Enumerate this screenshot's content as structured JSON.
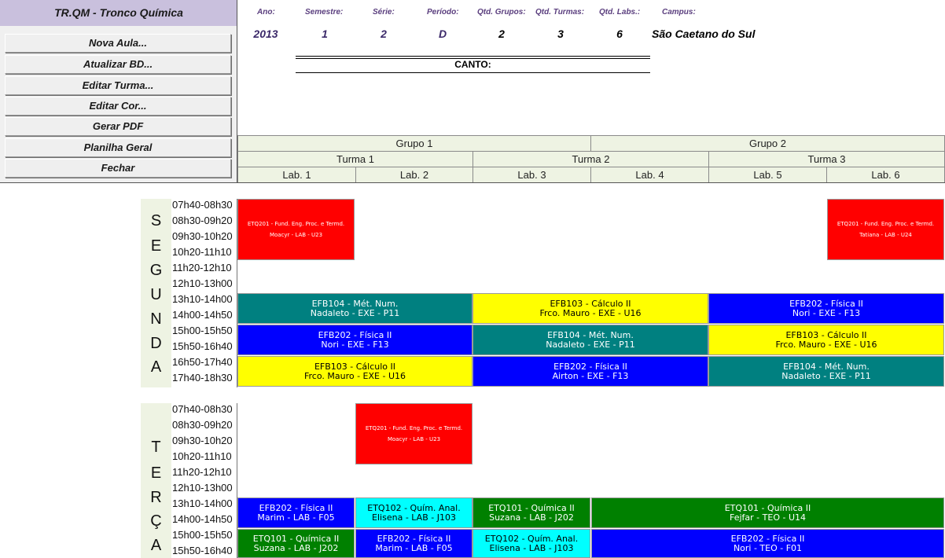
{
  "app": {
    "title": "TR.QM - Tronco Química"
  },
  "menu": {
    "nova_aula": "Nova Aula...",
    "atualizar_bd": "Atualizar BD...",
    "editar_turma": "Editar Turma...",
    "editar_cor": "Editar Cor...",
    "gerar_pdf": "Gerar PDF",
    "planilha_geral": "Planilha Geral",
    "fechar": "Fechar"
  },
  "info": {
    "labels": {
      "ano": "Ano:",
      "semestre": "Semestre:",
      "serie": "Série:",
      "periodo": "Período:",
      "qtd_grupos": "Qtd. Grupos:",
      "qtd_turmas": "Qtd. Turmas:",
      "qtd_labs": "Qtd. Labs.:",
      "campus": "Campus:"
    },
    "values": {
      "ano": "2013",
      "semestre": "1",
      "serie": "2",
      "periodo": "D",
      "qtd_grupos": "2",
      "qtd_turmas": "3",
      "qtd_labs": "6",
      "campus": "São Caetano do Sul"
    },
    "canto_label": "CANTO:"
  },
  "header": {
    "grupos": [
      "Grupo 1",
      "Grupo 2"
    ],
    "turmas": [
      "Turma 1",
      "Turma 2",
      "Turma 3"
    ],
    "labs": [
      "Lab. 1",
      "Lab. 2",
      "Lab. 3",
      "Lab. 4",
      "Lab. 5",
      "Lab. 6"
    ]
  },
  "times": [
    "07h40-08h30",
    "08h30-09h20",
    "09h30-10h20",
    "10h20-11h10",
    "11h20-12h10",
    "12h10-13h00",
    "13h10-14h00",
    "14h00-14h50",
    "15h00-15h50",
    "15h50-16h40",
    "16h50-17h40",
    "17h40-18h30"
  ],
  "days": {
    "segunda": {
      "letters": [
        "S",
        "E",
        "G",
        "U",
        "N",
        "D",
        "A"
      ]
    },
    "terca": {
      "letters": [
        "T",
        "E",
        "R",
        "Ç",
        "A"
      ]
    }
  },
  "colors": {
    "red": "#ff0000",
    "teal": "#008080",
    "yellow": "#ffff00",
    "blue": "#0000ff",
    "cyan": "#00ffff",
    "green": "#008000",
    "header_bg": "#eef3e3",
    "title_bg": "#c9c0dd"
  },
  "blocks": {
    "segunda": [
      {
        "line1": "ETQ201 - Fund. Eng. Proc. e Termd.",
        "line2": "Moacyr - LAB - U23",
        "color": "red"
      },
      {
        "line1": "ETQ201 - Fund. Eng. Proc. e Termd.",
        "line2": "Tatiana - LAB - U24",
        "color": "red"
      },
      {
        "line1": "EFB104 - Mét. Num.",
        "line2": "Nadaleto - EXE - P11",
        "color": "teal"
      },
      {
        "line1": "EFB103 - Cálculo II",
        "line2": "Frco. Mauro - EXE - U16",
        "color": "yellow"
      },
      {
        "line1": "EFB202 - Física II",
        "line2": "Nori - EXE - F13",
        "color": "blue"
      },
      {
        "line1": "EFB202 - Física II",
        "line2": "Nori - EXE - F13",
        "color": "blue"
      },
      {
        "line1": "EFB104 - Mét. Num.",
        "line2": "Nadaleto - EXE - P11",
        "color": "teal"
      },
      {
        "line1": "EFB103 - Cálculo II",
        "line2": "Frco. Mauro - EXE - U16",
        "color": "yellow"
      },
      {
        "line1": "EFB103 - Cálculo II",
        "line2": "Frco. Mauro - EXE - U16",
        "color": "yellow"
      },
      {
        "line1": "EFB202 - Física II",
        "line2": "Airton - EXE - F13",
        "color": "blue"
      },
      {
        "line1": "EFB104 - Mét. Num.",
        "line2": "Nadaleto - EXE - P11",
        "color": "teal"
      }
    ],
    "terca": [
      {
        "line1": "ETQ201 - Fund. Eng. Proc. e Termd.",
        "line2": "Moacyr - LAB - U23",
        "color": "red"
      },
      {
        "line1": "EFB202 - Física II",
        "line2": "Marim - LAB - F05",
        "color": "blue"
      },
      {
        "line1": "ETQ102 - Quím. Anal.",
        "line2": "Elisena - LAB - J103",
        "color": "cyan"
      },
      {
        "line1": "ETQ101 - Química II",
        "line2": "Suzana - LAB - J202",
        "color": "green"
      },
      {
        "line1": "ETQ101 - Química II",
        "line2": "Fejfar - TEO - U14",
        "color": "green"
      },
      {
        "line1": "ETQ101 - Química II",
        "line2": "Suzana - LAB - J202",
        "color": "green"
      },
      {
        "line1": "EFB202 - Física II",
        "line2": "Marim - LAB - F05",
        "color": "blue"
      },
      {
        "line1": "ETQ102 - Quím. Anal.",
        "line2": "Elisena - LAB - J103",
        "color": "cyan"
      },
      {
        "line1": "EFB202 - Física II",
        "line2": "Nori - TEO - F01",
        "color": "blue"
      }
    ]
  }
}
